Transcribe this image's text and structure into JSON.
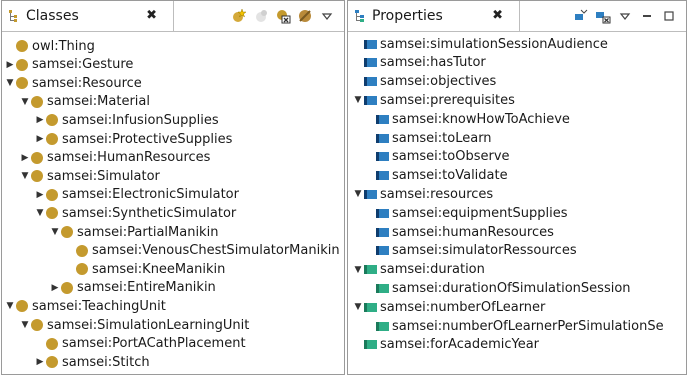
{
  "classes_view": {
    "tab_title": "Classes",
    "close_glyph": "✖",
    "tree": [
      {
        "label": "owl:Thing",
        "depth": 0,
        "arrow": "none"
      },
      {
        "label": "samsei:Gesture",
        "depth": 0,
        "arrow": "collapsed"
      },
      {
        "label": "samsei:Resource",
        "depth": 0,
        "arrow": "expanded"
      },
      {
        "label": "samsei:Material",
        "depth": 1,
        "arrow": "expanded"
      },
      {
        "label": "samsei:InfusionSupplies",
        "depth": 2,
        "arrow": "collapsed"
      },
      {
        "label": "samsei:ProtectiveSupplies",
        "depth": 2,
        "arrow": "collapsed"
      },
      {
        "label": "samsei:HumanResources",
        "depth": 1,
        "arrow": "collapsed"
      },
      {
        "label": "samsei:Simulator",
        "depth": 1,
        "arrow": "expanded"
      },
      {
        "label": "samsei:ElectronicSimulator",
        "depth": 2,
        "arrow": "collapsed"
      },
      {
        "label": "samsei:SyntheticSimulator",
        "depth": 2,
        "arrow": "expanded"
      },
      {
        "label": "samsei:PartialManikin",
        "depth": 3,
        "arrow": "expanded"
      },
      {
        "label": "samsei:VenousChestSimulatorManikin",
        "depth": 4,
        "arrow": "none"
      },
      {
        "label": "samsei:KneeManikin",
        "depth": 4,
        "arrow": "none"
      },
      {
        "label": "samsei:EntireManikin",
        "depth": 3,
        "arrow": "collapsed"
      },
      {
        "label": "samsei:TeachingUnit",
        "depth": 0,
        "arrow": "expanded"
      },
      {
        "label": "samsei:SimulationLearningUnit",
        "depth": 1,
        "arrow": "expanded"
      },
      {
        "label": "samsei:PortACathPlacement",
        "depth": 2,
        "arrow": "none"
      },
      {
        "label": "samsei:Stitch",
        "depth": 2,
        "arrow": "collapsed"
      }
    ]
  },
  "properties_view": {
    "tab_title": "Properties",
    "close_glyph": "✖",
    "tree": [
      {
        "label": "samsei:simulationSessionAudience",
        "depth": 0,
        "arrow": "none",
        "kind": "object"
      },
      {
        "label": "samsei:hasTutor",
        "depth": 0,
        "arrow": "none",
        "kind": "object"
      },
      {
        "label": "samsei:objectives",
        "depth": 0,
        "arrow": "none",
        "kind": "object"
      },
      {
        "label": "samsei:prerequisites",
        "depth": 0,
        "arrow": "expanded",
        "kind": "object"
      },
      {
        "label": "samsei:knowHowToAchieve",
        "depth": 1,
        "arrow": "none",
        "kind": "object"
      },
      {
        "label": "samsei:toLearn",
        "depth": 1,
        "arrow": "none",
        "kind": "object"
      },
      {
        "label": "samsei:toObserve",
        "depth": 1,
        "arrow": "none",
        "kind": "object"
      },
      {
        "label": "samsei:toValidate",
        "depth": 1,
        "arrow": "none",
        "kind": "object"
      },
      {
        "label": "samsei:resources",
        "depth": 0,
        "arrow": "expanded",
        "kind": "object"
      },
      {
        "label": "samsei:equipmentSupplies",
        "depth": 1,
        "arrow": "none",
        "kind": "object"
      },
      {
        "label": "samsei:humanResources",
        "depth": 1,
        "arrow": "none",
        "kind": "object"
      },
      {
        "label": "samsei:simulatorRessources",
        "depth": 1,
        "arrow": "none",
        "kind": "object"
      },
      {
        "label": "samsei:duration",
        "depth": 0,
        "arrow": "expanded",
        "kind": "data"
      },
      {
        "label": "samsei:durationOfSimulationSession",
        "depth": 1,
        "arrow": "none",
        "kind": "data"
      },
      {
        "label": "samsei:numberOfLearner",
        "depth": 0,
        "arrow": "expanded",
        "kind": "data"
      },
      {
        "label": "samsei:numberOfLearnerPerSimulationSe",
        "depth": 1,
        "arrow": "none",
        "kind": "data"
      },
      {
        "label": "samsei:forAcademicYear",
        "depth": 0,
        "arrow": "none",
        "kind": "data"
      }
    ]
  },
  "icons": {
    "classes_tab": "class-hierarchy-icon",
    "properties_tab": "property-hierarchy-icon",
    "class_node": "class-circle-icon",
    "object_property": "object-property-icon",
    "data_property": "data-property-icon"
  },
  "colors": {
    "class_dot": "#c49a2e",
    "object_property": "#2e7fc1",
    "data_property": "#2fae86"
  }
}
